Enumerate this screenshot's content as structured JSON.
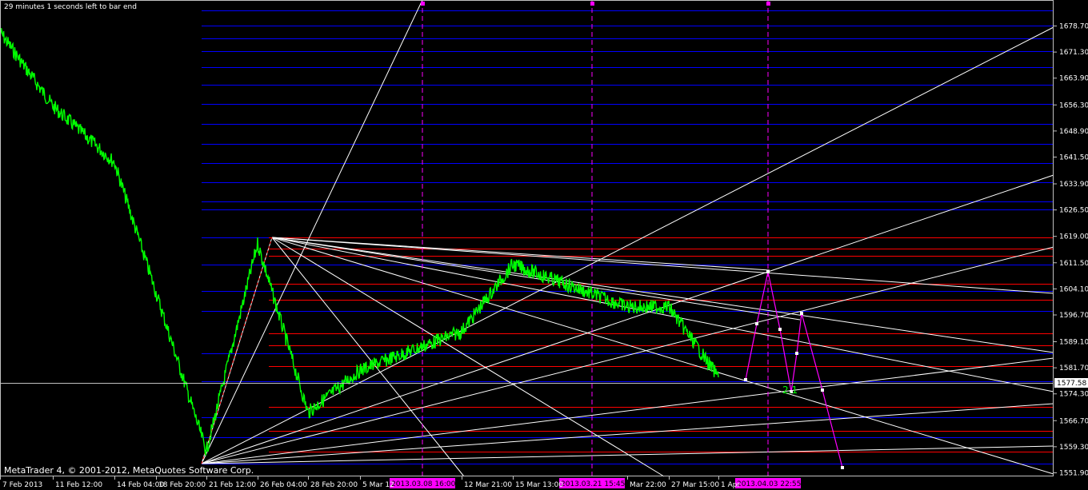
{
  "status_text": "29 minutes 1 seconds left to bar end",
  "copyright_text": "MetaTrader 4, © 2001-2012, MetaQuotes Software Corp.",
  "current_price_label": "1577.58",
  "pattern_label": "2.1",
  "colors": {
    "background": "#000000",
    "price_line": "#00ff00",
    "level_blue": "#0000ff",
    "level_red": "#ff0000",
    "fan_lines": "#ffffff",
    "vertical_markers": "#ff00ff",
    "time_label_bg": "#ff00ff"
  },
  "chart_data": {
    "type": "line",
    "platform": "MetaTrader 4",
    "y_axis_ticks": [
      "1678.70",
      "1671.30",
      "1663.90",
      "1656.30",
      "1648.90",
      "1641.50",
      "1633.90",
      "1626.50",
      "1619.00",
      "1611.50",
      "1604.10",
      "1596.70",
      "1589.10",
      "1581.70",
      "1574.30",
      "1566.70",
      "1559.30",
      "1551.90"
    ],
    "x_axis_ticks": [
      "7 Feb 2013",
      "11 Feb 12:00",
      "14 Feb 04:00",
      "18 Feb 20:00",
      "21 Feb 12:00",
      "26 Feb 04:00",
      "28 Feb 20:00",
      "5 Mar 12",
      "12 Mar 21:00",
      "15 Mar 13:00",
      "Mar 22:00",
      "27 Mar 15:00",
      "1 Apr"
    ],
    "vertical_time_markers": [
      "2013.03.08 16:00",
      "2013.03.21 15:45",
      "2013.04.03 22:55"
    ],
    "current_price": 1577.58,
    "ylim": [
      1551.9,
      1678.7
    ],
    "series": [
      {
        "values": [
          {
            "x": "7 Feb 2013",
            "y": 1677
          },
          {
            "x": "11 Feb 12:00",
            "y": 1656
          },
          {
            "x": "14 Feb 04:00",
            "y": 1640
          },
          {
            "x": "18 Feb 20:00",
            "y": 1603
          },
          {
            "x": "21 Feb 12:00",
            "y": 1558
          },
          {
            "x": "26 Feb 04:00",
            "y": 1617
          },
          {
            "x": "28 Feb 20:00",
            "y": 1569
          },
          {
            "x": "5 Mar 12",
            "y": 1581
          },
          {
            "x": "12 Mar 21:00",
            "y": 1592
          },
          {
            "x": "15 Mar 13:00",
            "y": 1611
          },
          {
            "x": "Mar 22:00",
            "y": 1599
          },
          {
            "x": "27 Mar 15:00",
            "y": 1599
          },
          {
            "x": "1 Apr",
            "y": 1579
          }
        ]
      }
    ]
  }
}
